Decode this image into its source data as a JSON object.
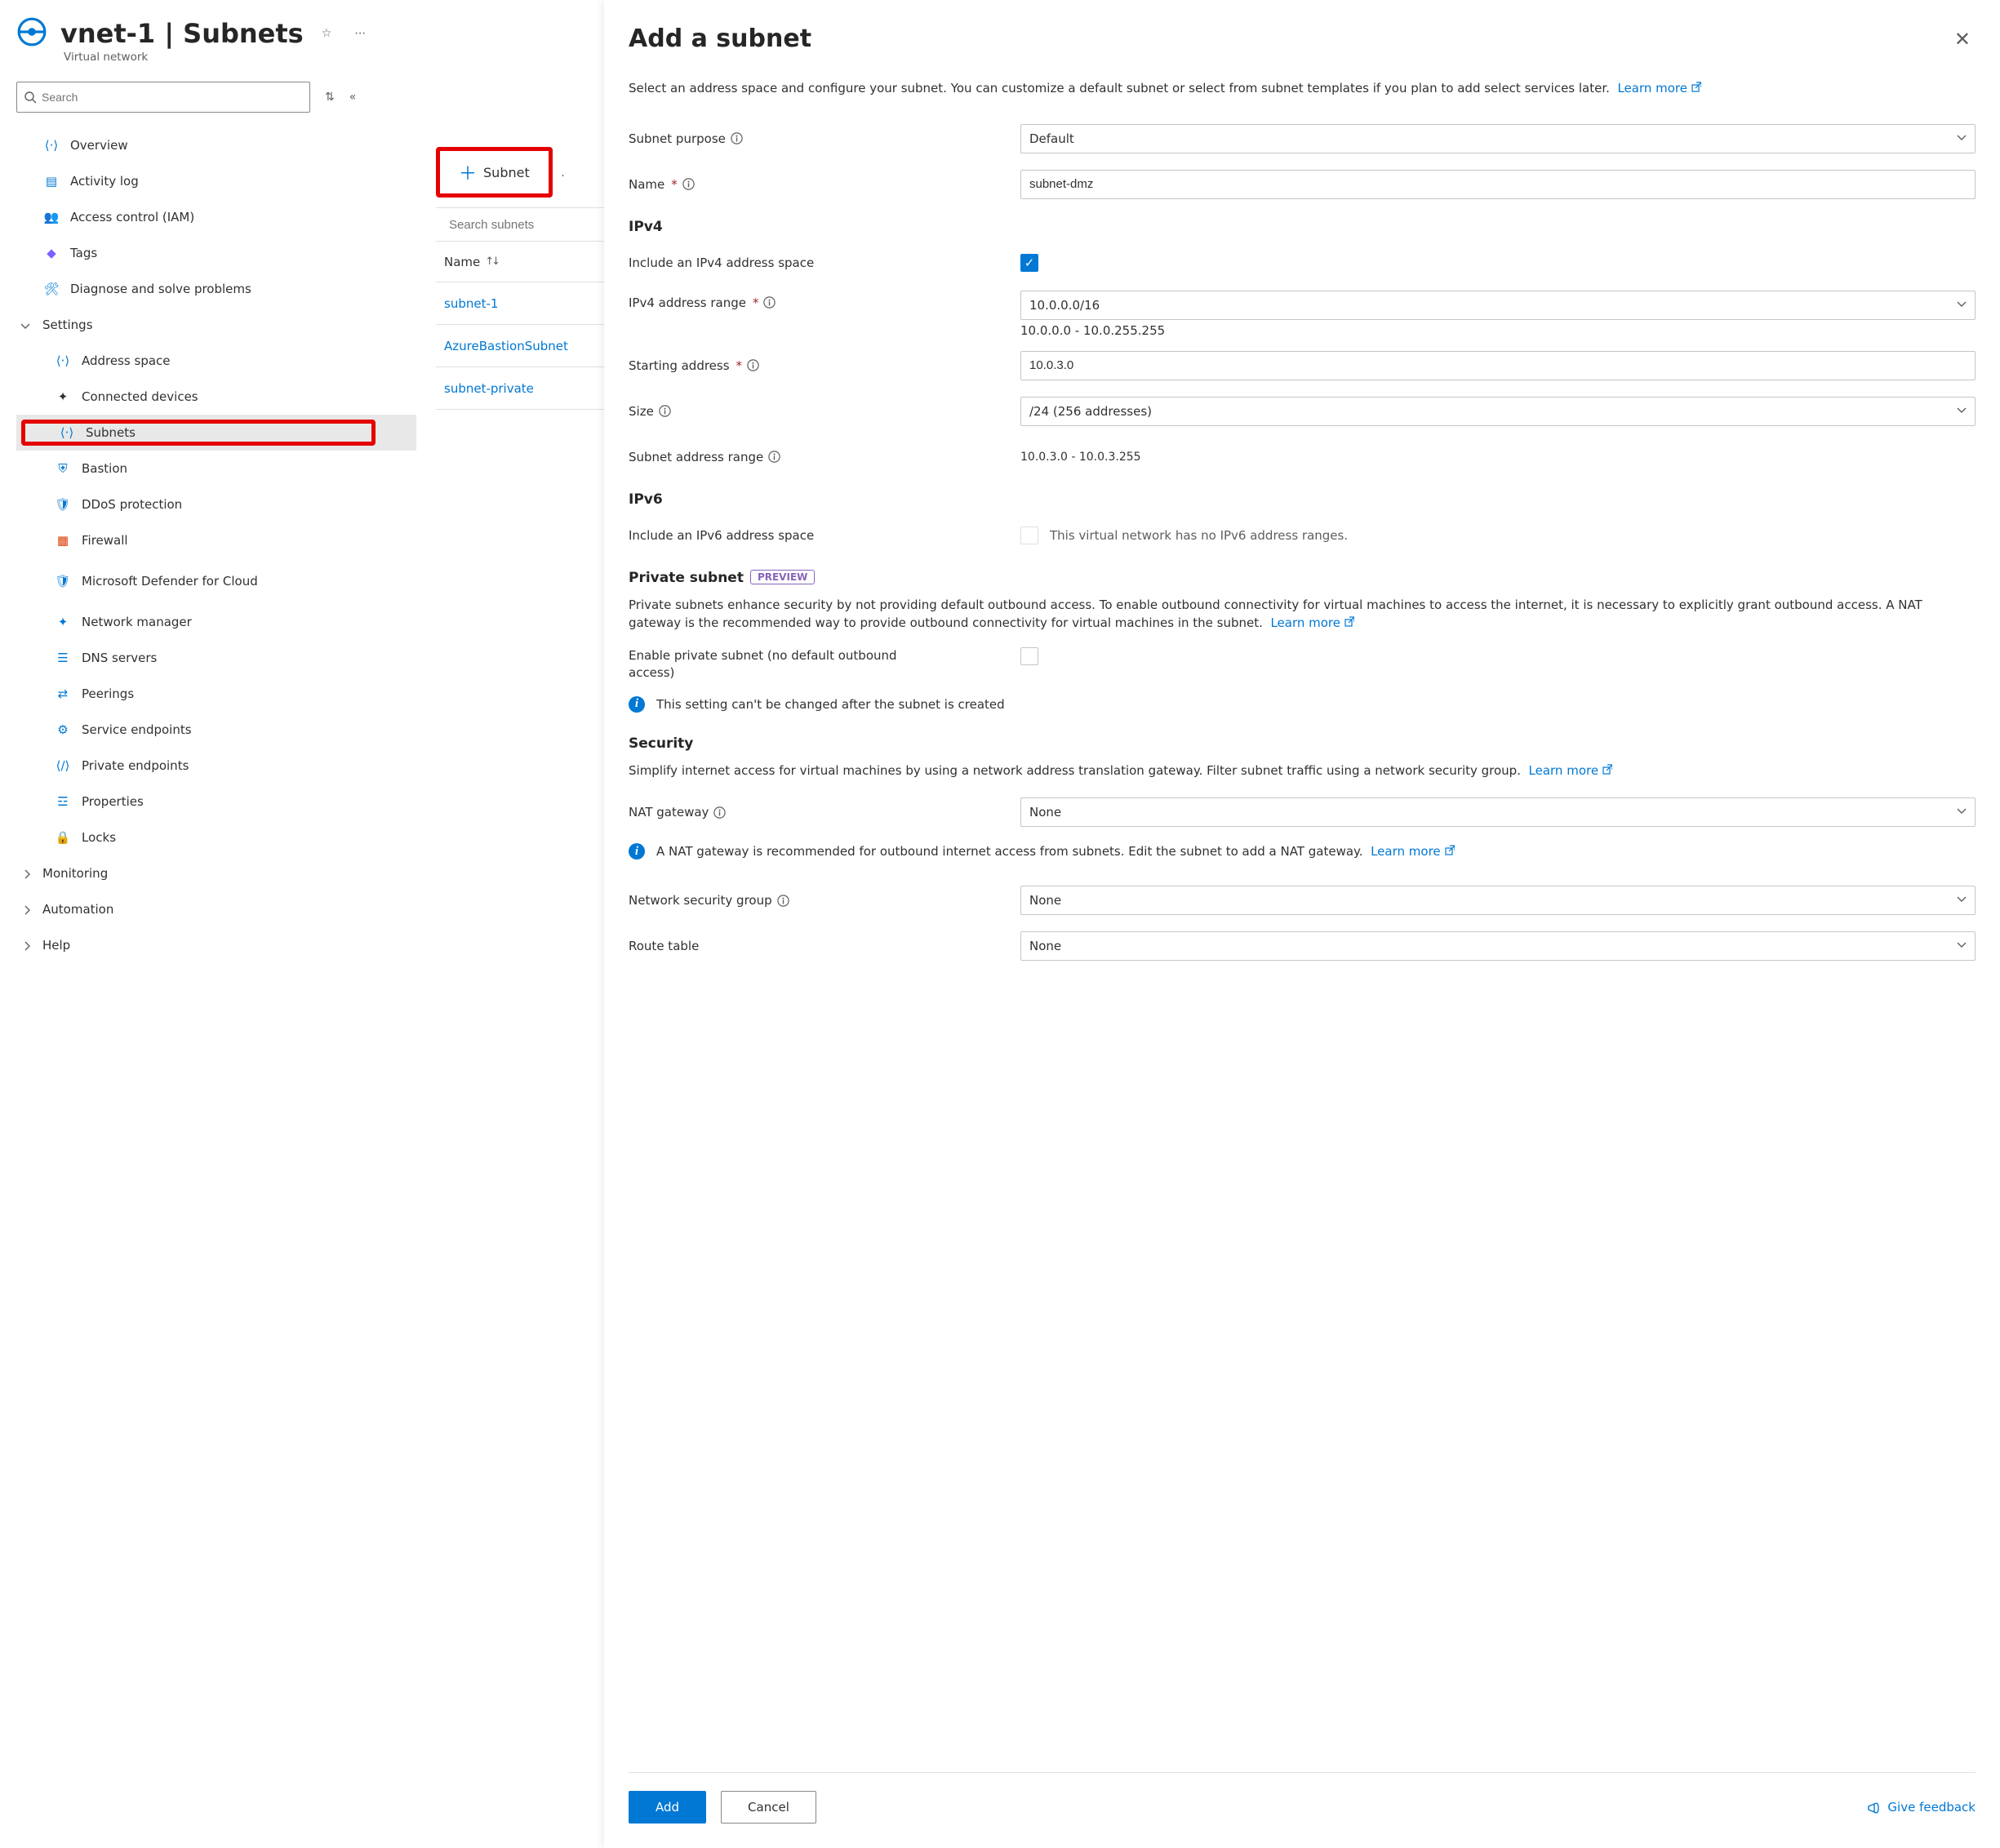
{
  "header": {
    "title": "vnet-1 | Subnets",
    "subtitle": "Virtual network"
  },
  "search": {
    "placeholder": "Search"
  },
  "nav": {
    "overview": "Overview",
    "activity": "Activity log",
    "iam": "Access control (IAM)",
    "tags": "Tags",
    "diagnose": "Diagnose and solve problems",
    "settings": "Settings",
    "address": "Address space",
    "devices": "Connected devices",
    "subnets": "Subnets",
    "bastion": "Bastion",
    "ddos": "DDoS protection",
    "firewall": "Firewall",
    "defender": "Microsoft Defender for Cloud",
    "netmgr": "Network manager",
    "dns": "DNS servers",
    "peerings": "Peerings",
    "svcend": "Service endpoints",
    "privend": "Private endpoints",
    "props": "Properties",
    "locks": "Locks",
    "monitoring": "Monitoring",
    "automation": "Automation",
    "help": "Help"
  },
  "mid": {
    "addSubnet": "Subnet",
    "searchPlaceholder": "Search subnets",
    "colName": "Name",
    "rows": [
      "subnet-1",
      "AzureBastionSubnet",
      "subnet-private"
    ]
  },
  "flyout": {
    "title": "Add a subnet",
    "intro": "Select an address space and configure your subnet. You can customize a default subnet or select from subnet templates if you plan to add select services later.",
    "learnMore": "Learn more",
    "purposeLabel": "Subnet purpose",
    "purposeValue": "Default",
    "nameLabel": "Name",
    "nameValue": "subnet-dmz",
    "ipv4Head": "IPv4",
    "includeIpv4": "Include an IPv4 address space",
    "rangeLabel": "IPv4 address range",
    "rangeValue": "10.0.0.0/16",
    "rangeReadout": "10.0.0.0 - 10.0.255.255",
    "startLabel": "Starting address",
    "startValue": "10.0.3.0",
    "sizeLabel": "Size",
    "sizeValue": "/24 (256 addresses)",
    "subnetRangeLabel": "Subnet address range",
    "subnetRangeValue": "10.0.3.0 - 10.0.3.255",
    "ipv6Head": "IPv6",
    "includeIpv6": "Include an IPv6 address space",
    "ipv6Hint": "This virtual network has no IPv6 address ranges.",
    "privateHead": "Private subnet",
    "preview": "PREVIEW",
    "privatePara": "Private subnets enhance security by not providing default outbound access. To enable outbound connectivity for virtual machines to access the internet, it is necessary to explicitly grant outbound access. A NAT gateway is the recommended way to provide outbound connectivity for virtual machines in the subnet.",
    "enablePrivate": "Enable private subnet (no default outbound access)",
    "privateNote": "This setting can't be changed after the subnet is created",
    "securityHead": "Security",
    "securityPara": "Simplify internet access for virtual machines by using a network address translation gateway. Filter subnet traffic using a network security group.",
    "natLabel": "NAT gateway",
    "natValue": "None",
    "natNote": "A NAT gateway is recommended for outbound internet access from subnets. Edit the subnet to add a NAT gateway.",
    "nsgLabel": "Network security group",
    "nsgValue": "None",
    "routeLabel": "Route table",
    "routeValue": "None",
    "addBtn": "Add",
    "cancelBtn": "Cancel",
    "feedback": "Give feedback"
  }
}
